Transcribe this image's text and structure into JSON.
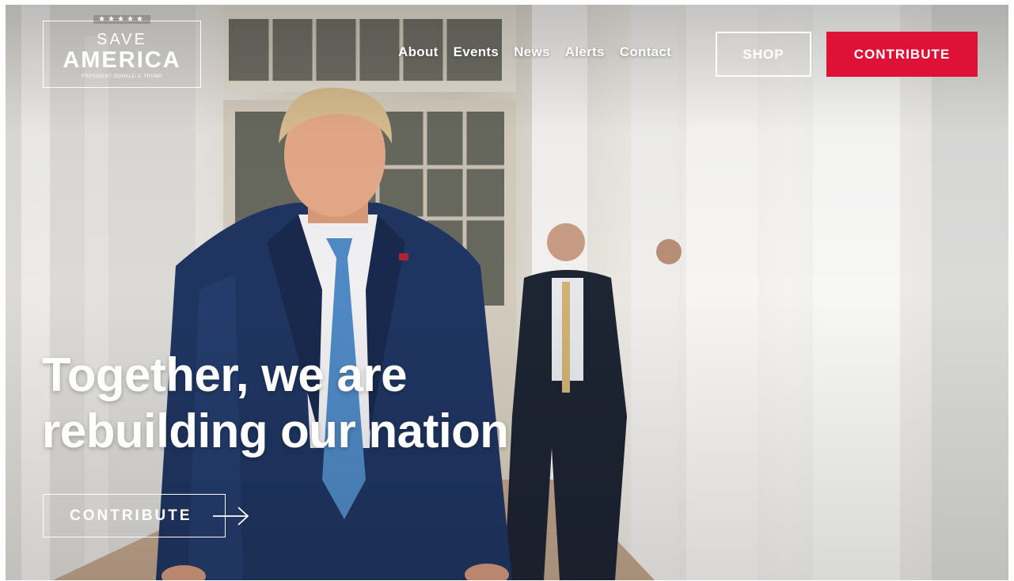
{
  "logo": {
    "stars": "★★★★★",
    "line1": "SAVE",
    "line2": "AMERICA",
    "subtitle": "PRESIDENT DONALD J. TRUMP"
  },
  "nav": {
    "items": [
      {
        "label": "About"
      },
      {
        "label": "Events"
      },
      {
        "label": "News"
      },
      {
        "label": "Alerts"
      },
      {
        "label": "Contact"
      }
    ]
  },
  "header": {
    "shop_label": "SHOP",
    "contribute_label": "CONTRIBUTE"
  },
  "hero": {
    "headline_line1": "Together, we are",
    "headline_line2": "rebuilding our nation",
    "cta_label": "CONTRIBUTE",
    "cta_icon": "arrow-right-icon"
  },
  "colors": {
    "accent": "#dd1236",
    "text": "#ffffff"
  }
}
